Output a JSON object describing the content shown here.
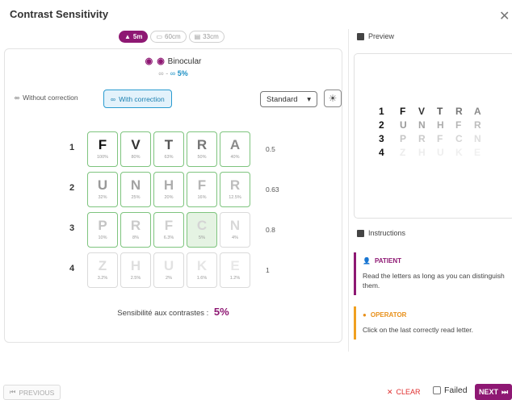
{
  "title": "Contrast Sensitivity",
  "distance_pills": [
    {
      "label": "5m",
      "icon": "mountain-icon",
      "active": true
    },
    {
      "label": "60cm",
      "icon": "monitor-icon",
      "active": false
    },
    {
      "label": "33cm",
      "icon": "book-icon",
      "active": false
    }
  ],
  "mode": {
    "label": "Binocular",
    "eyes_glyph": "◉ ◉",
    "sub_prefix": "-",
    "sub_value": "5%"
  },
  "correction": {
    "without_label": "Without correction",
    "with_label": "With correction",
    "selected": "with"
  },
  "standard_select": {
    "value": "Standard",
    "caret": "▾"
  },
  "chart": {
    "rows": [
      {
        "num": "1",
        "value": "0.5",
        "tiles": [
          {
            "letter": "F",
            "pct": "100%",
            "color": "#111111"
          },
          {
            "letter": "V",
            "pct": "80%",
            "color": "#333333"
          },
          {
            "letter": "T",
            "pct": "63%",
            "color": "#555555"
          },
          {
            "letter": "R",
            "pct": "50%",
            "color": "#777777"
          },
          {
            "letter": "A",
            "pct": "40%",
            "color": "#8a8a8a"
          }
        ]
      },
      {
        "num": "2",
        "value": "0.63",
        "tiles": [
          {
            "letter": "U",
            "pct": "32%",
            "color": "#999999"
          },
          {
            "letter": "N",
            "pct": "25%",
            "color": "#a3a3a3"
          },
          {
            "letter": "H",
            "pct": "20%",
            "color": "#adadad"
          },
          {
            "letter": "F",
            "pct": "16%",
            "color": "#b5b5b5"
          },
          {
            "letter": "R",
            "pct": "12.5%",
            "color": "#bdbdbd"
          }
        ]
      },
      {
        "num": "3",
        "value": "0.8",
        "tiles": [
          {
            "letter": "P",
            "pct": "10%",
            "color": "#c4c4c4"
          },
          {
            "letter": "R",
            "pct": "8%",
            "color": "#cacaca"
          },
          {
            "letter": "F",
            "pct": "6.3%",
            "color": "#cfcfcf"
          },
          {
            "letter": "C",
            "pct": "5%",
            "color": "#d4d4d4",
            "selected": true
          },
          {
            "letter": "N",
            "pct": "4%",
            "color": "#d8d8d8",
            "dim": true
          }
        ]
      },
      {
        "num": "4",
        "value": "1",
        "tiles": [
          {
            "letter": "Z",
            "pct": "3.2%",
            "color": "#dcdcdc",
            "dim": true
          },
          {
            "letter": "H",
            "pct": "2.5%",
            "color": "#dfdfdf",
            "dim": true
          },
          {
            "letter": "U",
            "pct": "2%",
            "color": "#e2e2e2",
            "dim": true
          },
          {
            "letter": "K",
            "pct": "1.6%",
            "color": "#e5e5e5",
            "dim": true
          },
          {
            "letter": "E",
            "pct": "1.2%",
            "color": "#e8e8e8",
            "dim": true
          }
        ]
      }
    ]
  },
  "sensitivity": {
    "label": "Sensibilité aux contrastes :",
    "value": "5%"
  },
  "preview": {
    "header": "Preview",
    "rows": [
      {
        "num": "1",
        "letters": [
          "F",
          "V",
          "T",
          "R",
          "A"
        ],
        "colors": [
          "#111111",
          "#333333",
          "#555555",
          "#777777",
          "#8a8a8a"
        ]
      },
      {
        "num": "2",
        "letters": [
          "U",
          "N",
          "H",
          "F",
          "R"
        ],
        "colors": [
          "#999999",
          "#a3a3a3",
          "#adadad",
          "#b5b5b5",
          "#bdbdbd"
        ]
      },
      {
        "num": "3",
        "letters": [
          "P",
          "R",
          "F",
          "C",
          "N"
        ],
        "colors": [
          "#c4c4c4",
          "#cacaca",
          "#cfcfcf",
          "#d4d4d4",
          "#dedede"
        ]
      },
      {
        "num": "4",
        "letters": [
          "Z",
          "H",
          "U",
          "K",
          "E"
        ],
        "colors": [
          "#ececec",
          "#ededed",
          "#eeeeee",
          "#efefef",
          "#f0f0f0"
        ]
      }
    ]
  },
  "instructions": {
    "header": "Instructions",
    "patient_label": "PATIENT",
    "patient_text": "Read the letters as long as you can distinguish them.",
    "operator_label": "OPERATOR",
    "operator_text": "Click on the last correctly read letter."
  },
  "footer": {
    "previous": "PREVIOUS",
    "clear": "CLEAR",
    "failed": "Failed",
    "next": "NEXT"
  },
  "colors": {
    "accent": "#8e1873",
    "selected_tile": "#e5f3e3",
    "tile_border": "#7ec47e",
    "info_blue": "#2a9bd0",
    "operator_orange": "#f0a020"
  }
}
